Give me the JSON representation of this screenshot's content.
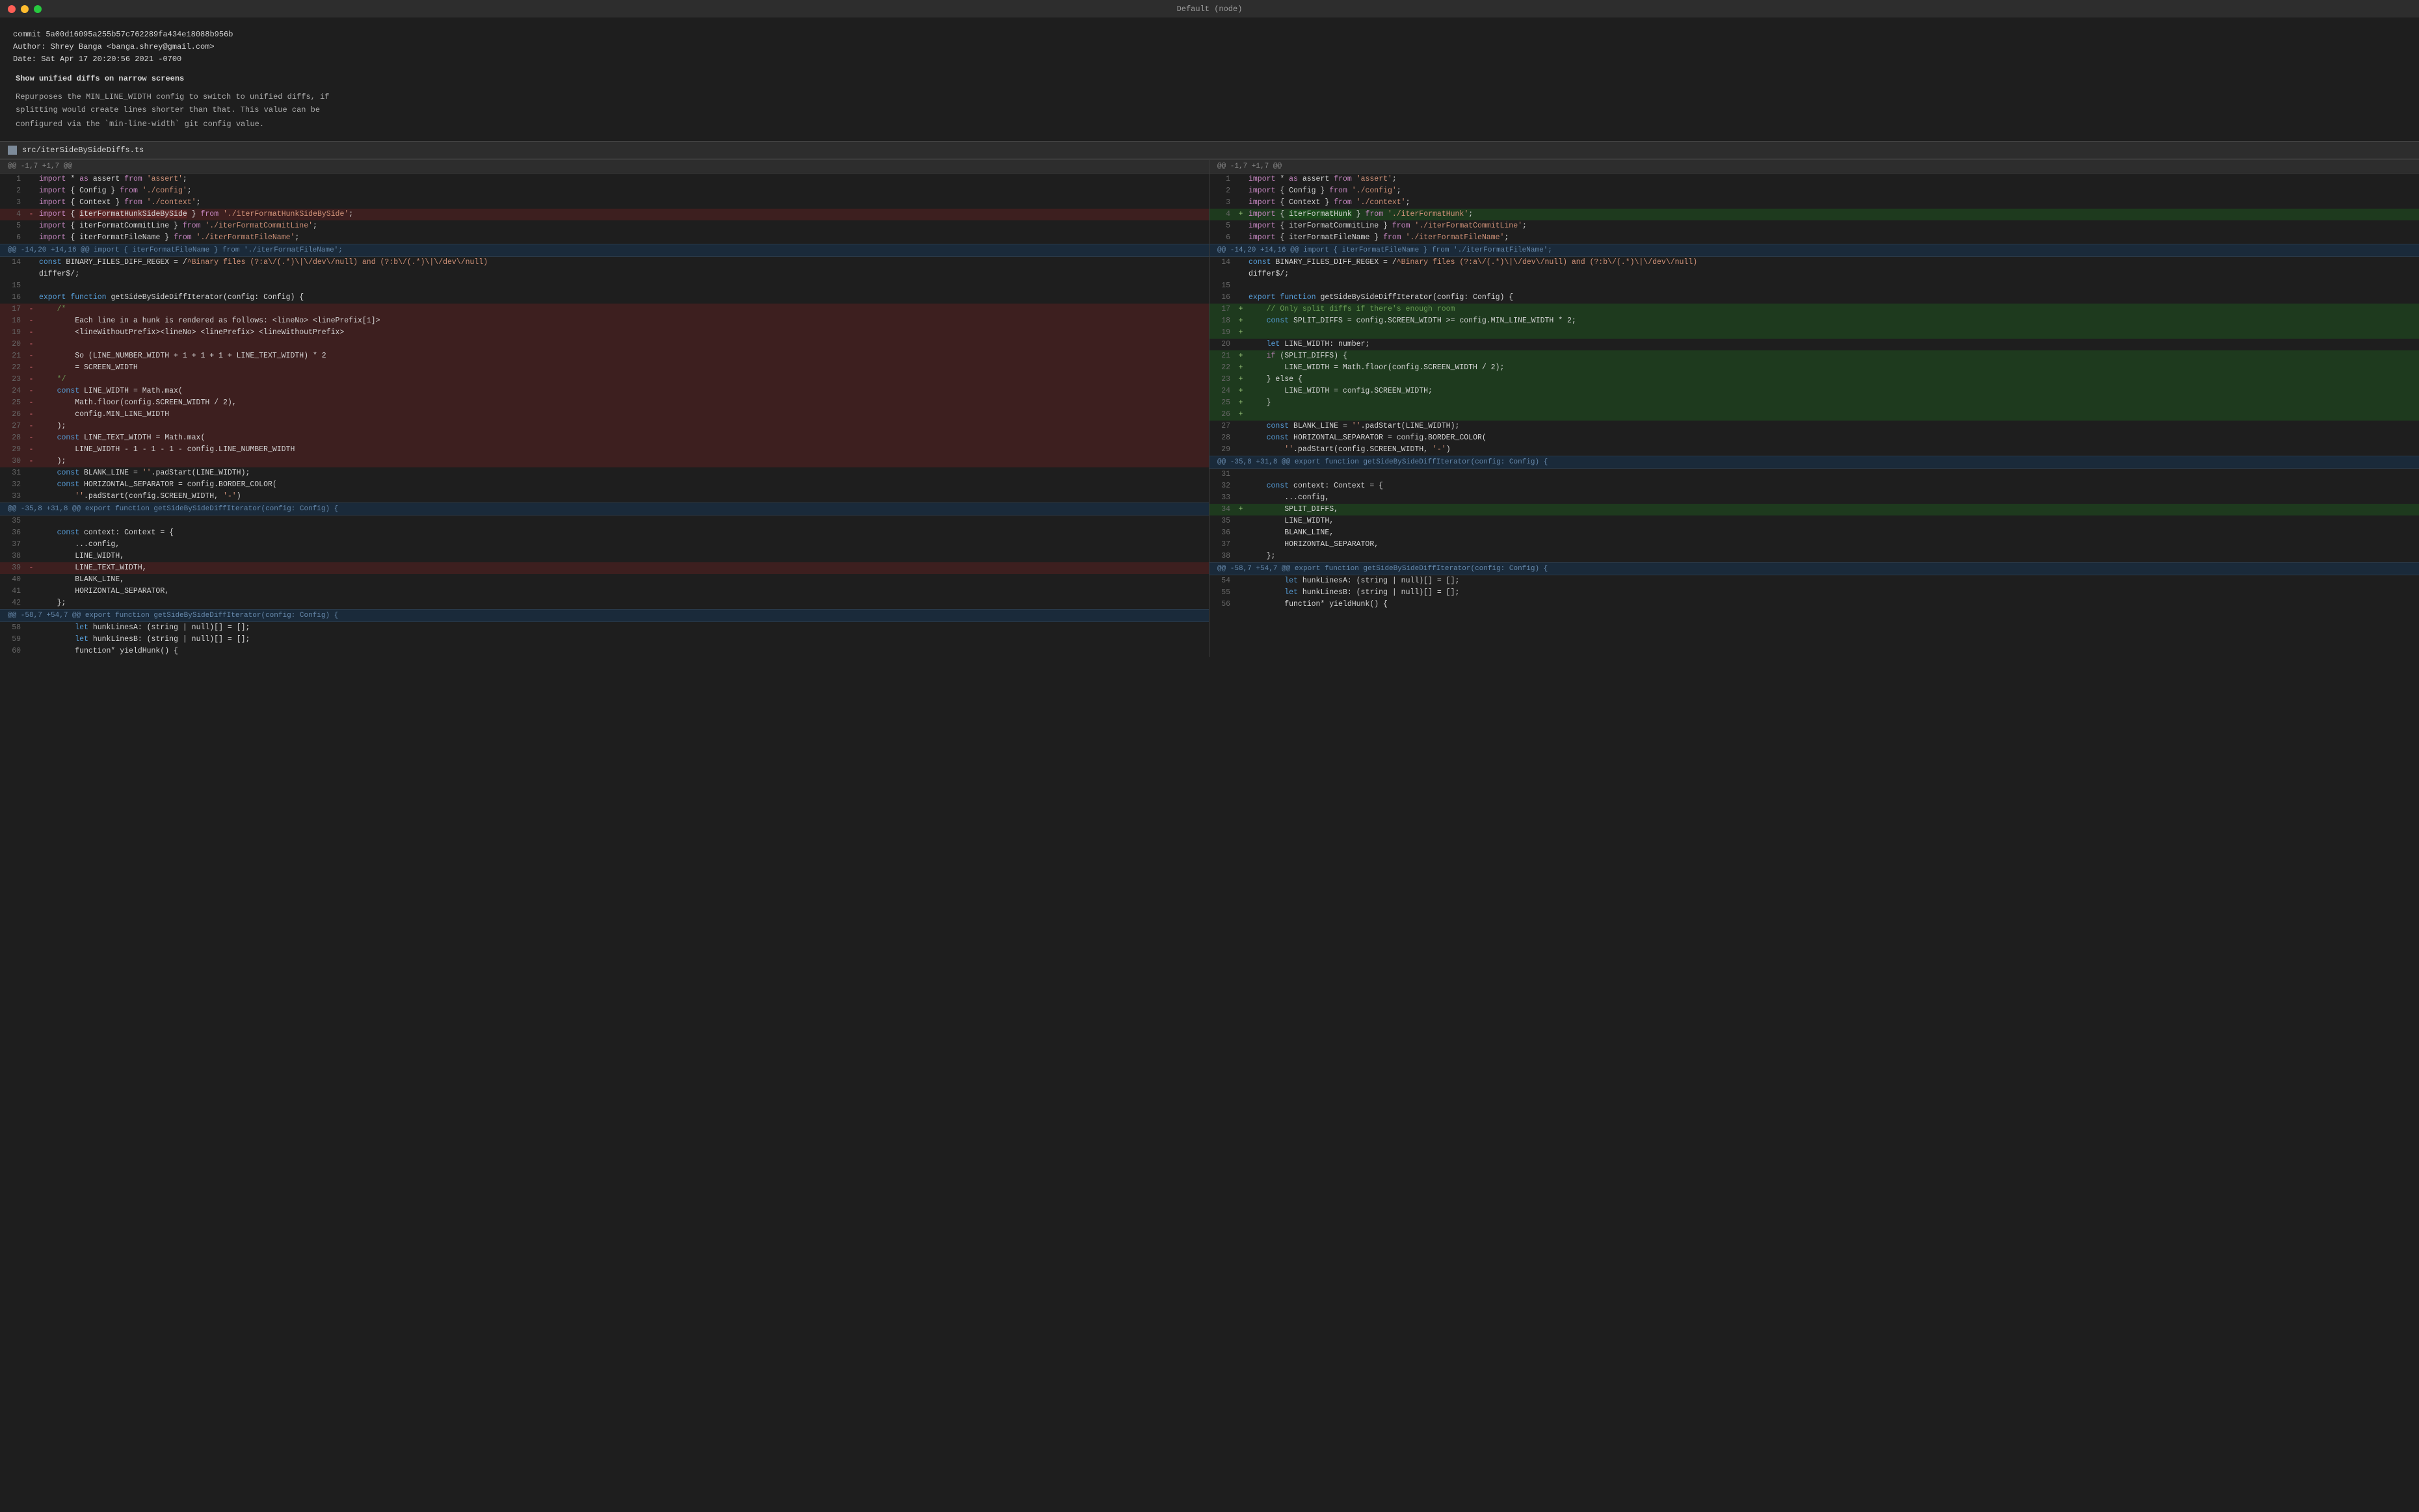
{
  "titlebar": {
    "title": "Default (node)",
    "buttons": [
      "close",
      "minimize",
      "maximize"
    ]
  },
  "commit": {
    "hash": "commit 5a00d16095a255b57c762289fa434e18088b956b",
    "author": "Author: Shrey Banga <banga.shrey@gmail.com>",
    "date": "Date:   Sat Apr 17 20:20:56 2021 -0700",
    "subject": "Show unified diffs on narrow screens",
    "body": "Repurposes the MIN_LINE_WIDTH config to switch to unified diffs, if\nsplitting would create lines shorter than that. This value can be\nconfigured via the `min-line-width` git config value."
  },
  "file": {
    "name": "src/iterSideBySideDiffs.ts"
  }
}
